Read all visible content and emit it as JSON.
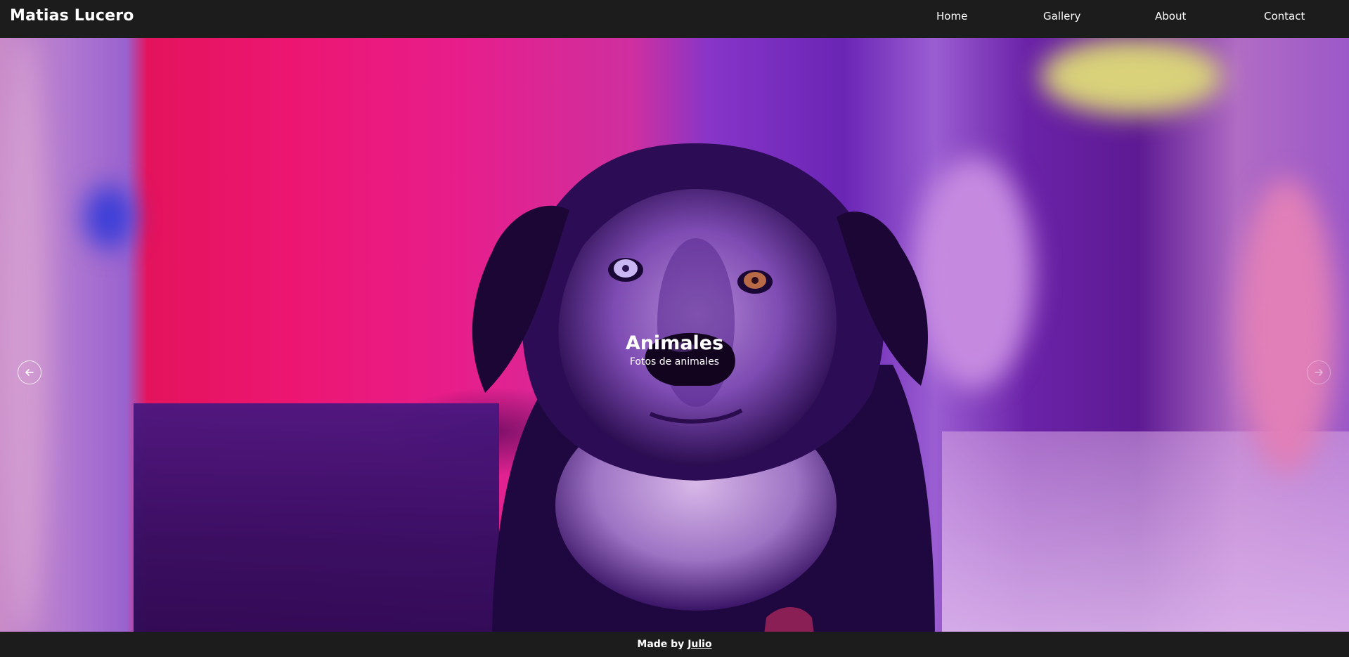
{
  "header": {
    "brand": "Matias Lucero",
    "nav": [
      {
        "label": "Home"
      },
      {
        "label": "Gallery"
      },
      {
        "label": "About"
      },
      {
        "label": "Contact"
      }
    ]
  },
  "carousel": {
    "slide": {
      "title": "Animales",
      "subtitle": "Fotos de animales"
    },
    "prev_icon": "arrow-left-icon",
    "next_icon": "arrow-right-icon"
  },
  "footer": {
    "prefix": "Made by",
    "author": "Julio"
  },
  "colors": {
    "bar_background": "#1c1c1c",
    "text": "#ffffff"
  }
}
